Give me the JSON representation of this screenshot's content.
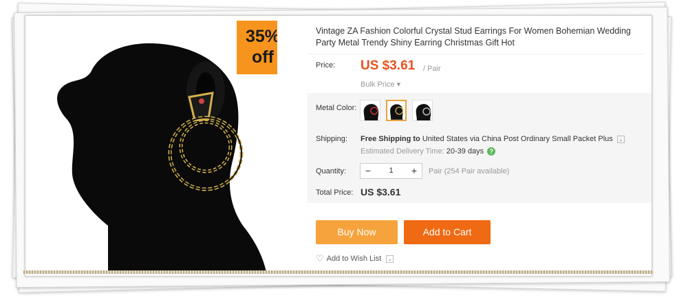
{
  "product": {
    "title": "Vintage ZA Fashion Colorful Crystal Stud Earrings For Women Bohemian Wedding Party Metal Trendy Shiny Earring Christmas Gift Hot",
    "discount_badge": {
      "line1": "35%",
      "line2": "off",
      "color": "#f7941e"
    }
  },
  "price": {
    "label": "Price:",
    "value": "US $3.61",
    "unit": "/ Pair",
    "bulk": "Bulk Price",
    "color": "#e8531f"
  },
  "metal_color": {
    "label": "Metal Color:",
    "options_count": 3,
    "selected_index": 1
  },
  "shipping": {
    "label": "Shipping:",
    "free_text": "Free Shipping to",
    "destination": "United States via China Post Ordinary Small Packet Plus",
    "estimate_label": "Estimated Delivery Time:",
    "estimate_days": "20-39 days",
    "help_icon": "question-circle-icon"
  },
  "quantity": {
    "label": "Quantity:",
    "minus": "−",
    "value": "1",
    "plus": "+",
    "available": "Pair (254 Pair available)"
  },
  "total": {
    "label": "Total Price:",
    "value": "US $3.61"
  },
  "actions": {
    "buy_now": "Buy Now",
    "add_to_cart": "Add to Cart",
    "wish_list": "Add to Wish List",
    "buy_color": "#f7a33d",
    "cart_color": "#f06a13"
  },
  "icons": {
    "wish": "heart-icon",
    "dropdown": "chevron-down-icon"
  }
}
